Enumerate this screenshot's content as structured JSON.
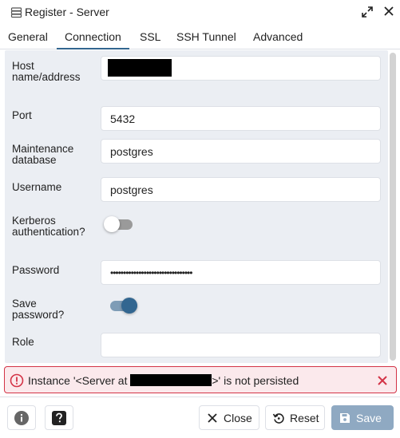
{
  "window": {
    "title": "Register - Server"
  },
  "tabs": [
    {
      "label": "General"
    },
    {
      "label": "Connection",
      "active": true
    },
    {
      "label": "SSL"
    },
    {
      "label": "SSH Tunnel"
    },
    {
      "label": "Advanced"
    }
  ],
  "form": {
    "host": {
      "label": "Host name/address",
      "value": "[redacted]"
    },
    "port": {
      "label": "Port",
      "value": "5432"
    },
    "maintenance_db": {
      "label": "Maintenance database",
      "value": "postgres"
    },
    "username": {
      "label": "Username",
      "value": "postgres"
    },
    "kerberos": {
      "label": "Kerberos authentication?",
      "enabled": false
    },
    "password": {
      "label": "Password",
      "value": "••••••••••••••••••••••••••••••••"
    },
    "save_password": {
      "label": "Save password?",
      "enabled": true
    },
    "role": {
      "label": "Role",
      "value": ""
    }
  },
  "error": {
    "prefix": "Instance '<Server at ",
    "suffix": ">' is not persisted"
  },
  "footer": {
    "info_icon": "info-icon",
    "help_icon": "help-icon",
    "close_label": "Close",
    "reset_label": "Reset",
    "save_label": "Save"
  },
  "colors": {
    "accent": "#326690",
    "error_border": "#d33346",
    "error_bg": "#fbe9ec",
    "save_disabled": "#8fa9c2",
    "form_bg": "#ebeef3"
  }
}
